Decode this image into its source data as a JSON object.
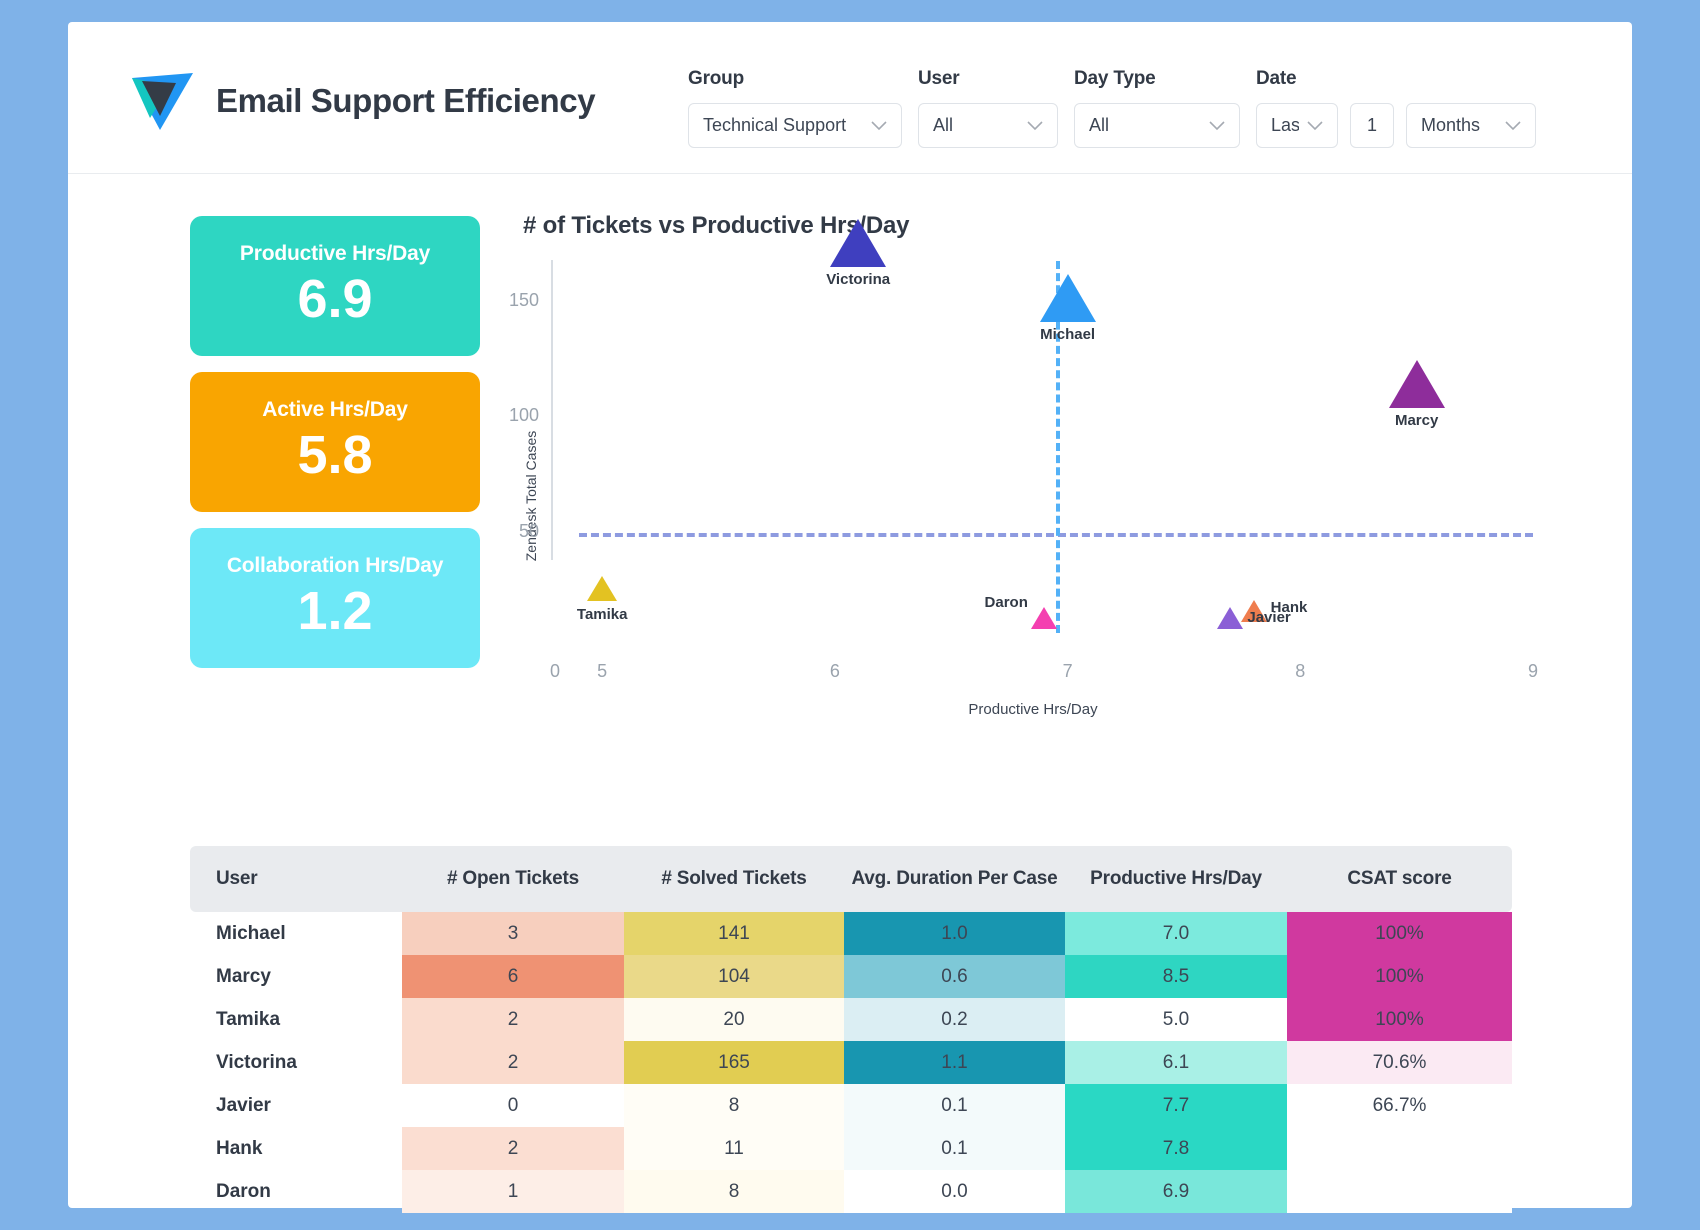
{
  "brand": {
    "title": "Email Support Efficiency",
    "logo_icon": "paper-plane-logo"
  },
  "filters": [
    {
      "label": "Group",
      "value": "Technical Support"
    },
    {
      "label": "User",
      "value": "All"
    },
    {
      "label": "Day Type",
      "value": "All"
    }
  ],
  "date_filter": {
    "label": "Date",
    "relative": "Last",
    "amount": "1",
    "unit": "Months"
  },
  "kpis": [
    {
      "label": "Productive Hrs/Day",
      "value": "6.9",
      "color": "#2ed6c2"
    },
    {
      "label": "Active Hrs/Day",
      "value": "5.8",
      "color": "#f9a501"
    },
    {
      "label": "Collaboration Hrs/Day",
      "value": "1.2",
      "color": "#6de8f7"
    }
  ],
  "chart_data": {
    "type": "scatter",
    "title": "# of Tickets vs Productive Hrs/Day",
    "xlabel": "Productive Hrs/Day",
    "ylabel": "Zendesk Total Cases",
    "xticks": [
      "0",
      "5",
      "6",
      "7",
      "8",
      "9"
    ],
    "yticks": [
      "50",
      "100",
      "150"
    ],
    "xlim": [
      4.78,
      9.0
    ],
    "ylim": [
      0,
      168
    ],
    "grid": false,
    "legend": "none",
    "reference_lines": {
      "vertical_x": 6.95,
      "vertical_color": "#53b1f7",
      "horizontal_y": 50,
      "horizontal_color": "#8e9be0"
    },
    "points": [
      {
        "name": "Victorina",
        "x": 6.1,
        "y": 165,
        "color": "#3f3fbf"
      },
      {
        "name": "Michael",
        "x": 7.0,
        "y": 141,
        "color": "#2f9bf4"
      },
      {
        "name": "Marcy",
        "x": 8.5,
        "y": 104,
        "color": "#8e2d9b"
      },
      {
        "name": "Tamika",
        "x": 5.0,
        "y": 20,
        "color": "#e3c222"
      },
      {
        "name": "Daron",
        "x": 6.9,
        "y": 8,
        "color": "#f43fb0"
      },
      {
        "name": "Hank",
        "x": 7.8,
        "y": 11,
        "color": "#ef7d4e"
      },
      {
        "name": "Javier",
        "x": 7.7,
        "y": 8,
        "color": "#8b5fd6"
      }
    ]
  },
  "table": {
    "columns": [
      "User",
      "# Open Tickets",
      "# Solved Tickets",
      "Avg. Duration Per Case",
      "Productive Hrs/Day",
      "CSAT score"
    ],
    "rows": [
      {
        "user": "Michael",
        "open": "3",
        "open_bg": "#f7cfbe",
        "solved": "141",
        "solved_bg": "#e5d46a",
        "duration": "1.0",
        "duration_bg": "#1896b0",
        "productive": "7.0",
        "productive_bg": "#7ceadd",
        "csat": "100%",
        "csat_bg": "#d0399f"
      },
      {
        "user": "Marcy",
        "open": "6",
        "open_bg": "#ef9273",
        "solved": "104",
        "solved_bg": "#ead989",
        "duration": "0.6",
        "duration_bg": "#7ec8d7",
        "productive": "8.5",
        "productive_bg": "#2ed6c2",
        "csat": "100%",
        "csat_bg": "#d0399f"
      },
      {
        "user": "Tamika",
        "open": "2",
        "open_bg": "#fadbcd",
        "solved": "20",
        "solved_bg": "#fefbf1",
        "duration": "0.2",
        "duration_bg": "#dbeef3",
        "productive": "5.0",
        "productive_bg": "#ffffff",
        "csat": "100%",
        "csat_bg": "#d0399f"
      },
      {
        "user": "Victorina",
        "open": "2",
        "open_bg": "#fadbcd",
        "solved": "165",
        "solved_bg": "#e1cd52",
        "duration": "1.1",
        "duration_bg": "#1896b0",
        "productive": "6.1",
        "productive_bg": "#a9f0e6",
        "csat": "70.6%",
        "csat_bg": "#fbeaf3"
      },
      {
        "user": "Javier",
        "open": "0",
        "open_bg": "#ffffff",
        "solved": "8",
        "solved_bg": "#fffdf6",
        "duration": "0.1",
        "duration_bg": "#f3fafb",
        "productive": "7.7",
        "productive_bg": "#2ad8c4",
        "csat": "66.7%",
        "csat_bg": "#ffffff"
      },
      {
        "user": "Hank",
        "open": "2",
        "open_bg": "#fbded2",
        "solved": "11",
        "solved_bg": "#fffdf6",
        "duration": "0.1",
        "duration_bg": "#f3fafb",
        "productive": "7.8",
        "productive_bg": "#2ad8c4",
        "csat": "",
        "csat_bg": "#ffffff"
      },
      {
        "user": "Daron",
        "open": "1",
        "open_bg": "#fdeee7",
        "solved": "8",
        "solved_bg": "#fffbef",
        "duration": "0.0",
        "duration_bg": "#ffffff",
        "productive": "6.9",
        "productive_bg": "#79e7da",
        "csat": "",
        "csat_bg": "#ffffff"
      }
    ]
  }
}
